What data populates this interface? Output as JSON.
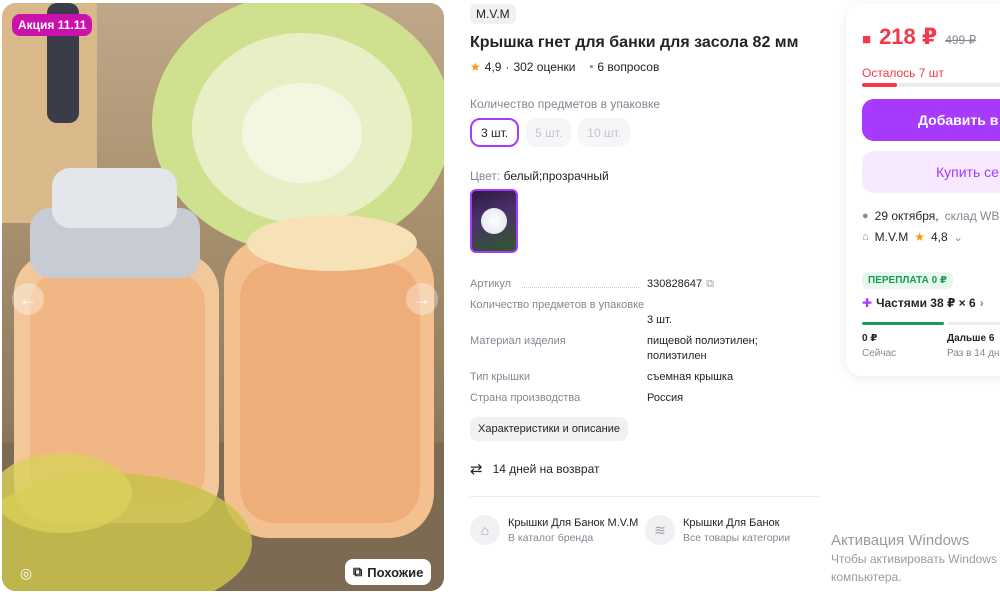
{
  "gallery": {
    "promo_badge": "Акция 11.11",
    "similar_label": "Похожие"
  },
  "product": {
    "brand": "M.V.M",
    "title": "Крышка гнет для банки для засола 82 мм",
    "rating": "4,9",
    "reviews": "302 оценки",
    "questions": "6 вопросов"
  },
  "quantity": {
    "label": "Количество предметов в упаковке",
    "options": [
      "3 шт.",
      "5 шт.",
      "10 шт."
    ],
    "selected": "3 шт."
  },
  "color": {
    "label": "Цвет:",
    "value": "белый;прозрачный"
  },
  "specs": [
    {
      "name": "Артикул",
      "value": "330828647"
    },
    {
      "name": "Количество предметов в упаковке",
      "value": "3 шт."
    },
    {
      "name": "Материал изделия",
      "value": "пищевой полиэтилен; полиэтилен"
    },
    {
      "name": "Тип крышки",
      "value": "съемная крышка"
    },
    {
      "name": "Страна производства",
      "value": "Россия"
    }
  ],
  "characteristics_button": "Характеристики и описание",
  "returns": "14 дней на возврат",
  "category_links": [
    {
      "title": "Крышки Для Банок M.V.M",
      "subtitle": "В каталог бренда"
    },
    {
      "title": "Крышки Для Банок",
      "subtitle": "Все товары категории"
    }
  ],
  "buy_card": {
    "price": "218 ₽",
    "old_price": "499 ₽",
    "stock_left": "Осталось 7 шт",
    "stock_fraction": 0.22,
    "add_to_cart": "Добавить в корзину",
    "buy_now": "Купить сейчас",
    "delivery_date": "29 октября,",
    "delivery_place": "склад WB",
    "seller": "M.V.M",
    "seller_rating": "4,8",
    "overpay": "ПЕРЕПЛАТА 0 ₽",
    "installments": "Частями 38 ₽ × 6",
    "inst_now_value": "0 ₽",
    "inst_now_label": "Сейчас",
    "inst_next_value": "Дальше 6",
    "inst_next_label": "Раз в 14 дн"
  },
  "watermark": {
    "title": "Активация Windows",
    "line1": "Чтобы активировать Windows",
    "line2": "компьютера."
  }
}
